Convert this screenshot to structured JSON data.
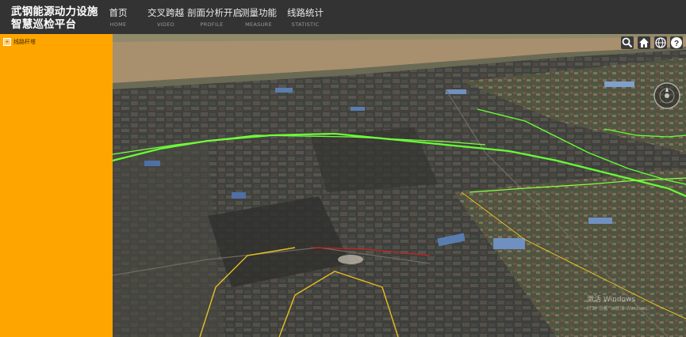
{
  "app": {
    "title": "武钢能源动力设施智慧巡检平台"
  },
  "nav": [
    {
      "label": "首页",
      "sub": "HOME"
    },
    {
      "label": "交叉跨越",
      "sub": "VIDEO"
    },
    {
      "label": "剖面分析开启",
      "sub": "PROFILE"
    },
    {
      "label": "测量功能",
      "sub": "MEASURE"
    },
    {
      "label": "线路统计",
      "sub": "STATISTIC"
    }
  ],
  "sidebar": {
    "tree": [
      {
        "label": "线路杆塔",
        "toggle": "+"
      }
    ]
  },
  "map_toolbar": [
    {
      "icon": "search-icon"
    },
    {
      "icon": "home-icon"
    },
    {
      "icon": "globe-icon"
    },
    {
      "icon": "help-icon"
    }
  ],
  "watermark": {
    "title": "激活 Windows",
    "subtitle": "转到\"设置\"以激活 Windows。"
  },
  "colors": {
    "header": "#333333",
    "sidebar": "#ffa500",
    "power_line_green": "#66ff33",
    "power_line_yellow": "#e8c020",
    "power_line_red": "#cc2222"
  }
}
